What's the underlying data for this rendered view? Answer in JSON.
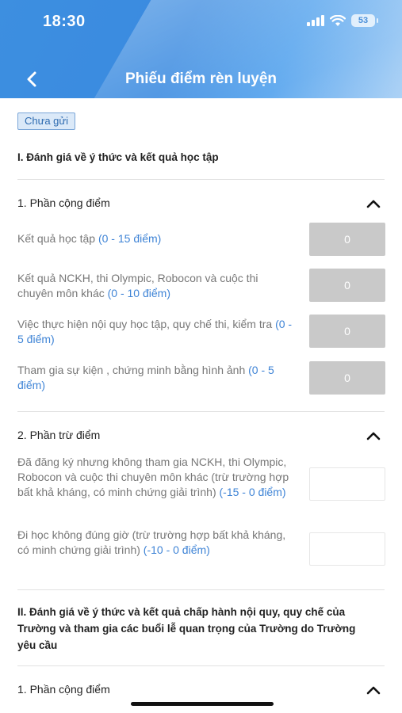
{
  "status": {
    "time": "18:30",
    "battery": "53"
  },
  "header": {
    "title": "Phiếu điểm rèn luyện"
  },
  "badge": "Chưa gửi",
  "section1": {
    "title": "I. Đánh giá về ý thức và kết quả học tập",
    "add": {
      "title": "1. Phần cộng điểm",
      "items": [
        {
          "label": "Kết quả học tập ",
          "range": "(0 - 15 điểm)",
          "value": "0"
        },
        {
          "label": "Kết quả NCKH, thi Olympic, Robocon và cuộc thi chuyên môn khác ",
          "range": "(0 - 10 điểm)",
          "value": "0"
        },
        {
          "label": "Việc thực hiện nội quy học tập, quy chế thi, kiểm tra ",
          "range": "(0 - 5 điểm)",
          "value": "0"
        },
        {
          "label": "Tham gia sự kiện , chứng minh bằng hình ảnh ",
          "range": "(0 - 5 điểm)",
          "value": "0"
        }
      ]
    },
    "sub": {
      "title": "2. Phần trừ điểm",
      "items": [
        {
          "label": "Đã đăng ký nhưng không tham gia NCKH, thi Olympic, Robocon và cuộc thi chuyên môn khác (trừ trường hợp bất khả kháng, có minh chứng giải trình) ",
          "range": "(-15 - 0 điểm)",
          "value": ""
        },
        {
          "label": "Đi học không đúng giờ (trừ trường hợp bất khả kháng, có minh chứng giải trình) ",
          "range": "(-10 - 0 điểm)",
          "value": ""
        }
      ]
    }
  },
  "section2": {
    "title": "II. Đánh giá về ý thức và kết quả chấp hành nội quy, quy chế của Trường và tham gia các buổi lễ quan trọng của Trường do Trường yêu cầu",
    "add": {
      "title": "1. Phần cộng điểm"
    }
  }
}
